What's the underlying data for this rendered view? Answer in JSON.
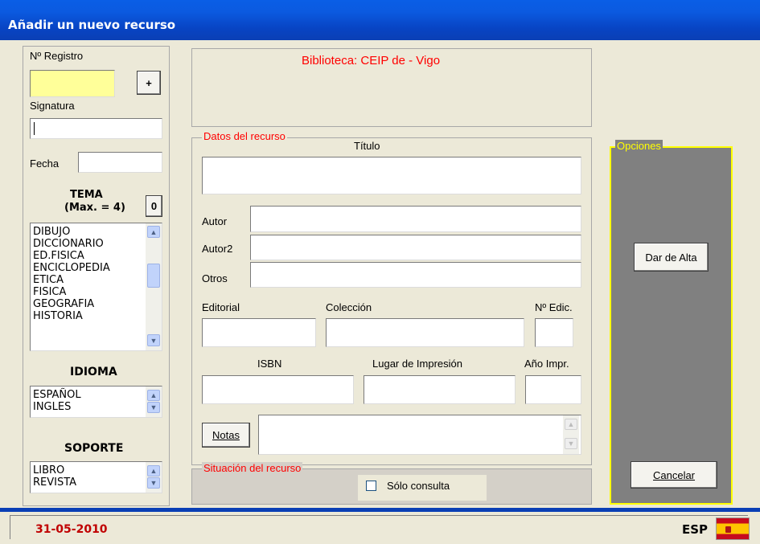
{
  "window": {
    "title": "Añadir un nuevo recurso"
  },
  "left": {
    "registro_label": "Nº Registro",
    "registro_value": "",
    "plus_label": "+",
    "signatura_label": "Signatura",
    "signatura_value": "",
    "fecha_label": "Fecha",
    "fecha_value": "",
    "tema_title": "TEMA",
    "tema_max": "(Max. = 4)",
    "tema_count": "0",
    "tema_items": [
      "DIBUJO",
      "DICCIONARIO",
      "ED.FISICA",
      "ENCICLOPEDIA",
      "ETICA",
      "FISICA",
      "GEOGRAFIA",
      "HISTORIA"
    ],
    "idioma_title": "IDIOMA",
    "idioma_items": [
      "ESPAÑOL",
      "INGLES"
    ],
    "soporte_title": "SOPORTE",
    "soporte_items": [
      "LIBRO",
      "REVISTA"
    ]
  },
  "header": {
    "biblioteca": "Biblioteca: CEIP de - Vigo"
  },
  "datos": {
    "legend": "Datos del recurso",
    "titulo_label": "Título",
    "autor_label": "Autor",
    "autor2_label": "Autor2",
    "otros_label": "Otros",
    "editorial_label": "Editorial",
    "coleccion_label": "Colección",
    "nedic_label": "Nº Edic.",
    "isbn_label": "ISBN",
    "lugar_label": "Lugar de Impresión",
    "anio_label": "Año Impr.",
    "notas_button": "Notas"
  },
  "situacion": {
    "legend": "Situación del recurso",
    "solo_consulta": "Sólo consulta",
    "solo_consulta_checked": false
  },
  "opciones": {
    "legend": "Opciones",
    "alta_button": "Dar de Alta",
    "cancelar_button": "Cancelar"
  },
  "status": {
    "date": "31-05-2010",
    "lang": "ESP"
  },
  "colors": {
    "accent_red": "#ff0000",
    "date_red": "#c00000",
    "registro_yellow": "#ffff99",
    "opciones_bg": "#808080",
    "titlebar": "#0a5ee6"
  }
}
